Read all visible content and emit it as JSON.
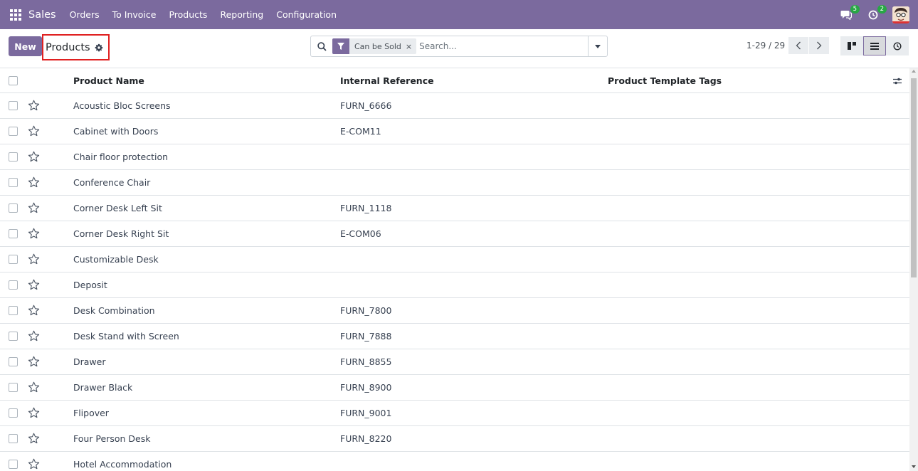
{
  "navbar": {
    "app_name": "Sales",
    "menu": [
      "Orders",
      "To Invoice",
      "Products",
      "Reporting",
      "Configuration"
    ],
    "messages_badge": "5",
    "activities_badge": "2"
  },
  "control_panel": {
    "new_label": "New",
    "title": "Products",
    "facet_label": "Can be Sold",
    "facet_close": "×",
    "search_placeholder": "Search...",
    "pager": "1-29 / 29"
  },
  "list": {
    "headers": {
      "name": "Product Name",
      "ref": "Internal Reference",
      "tags": "Product Template Tags"
    },
    "rows": [
      {
        "name": "Acoustic Bloc Screens",
        "ref": "FURN_6666"
      },
      {
        "name": "Cabinet with Doors",
        "ref": "E-COM11"
      },
      {
        "name": "Chair floor protection",
        "ref": ""
      },
      {
        "name": "Conference Chair",
        "ref": ""
      },
      {
        "name": "Corner Desk Left Sit",
        "ref": "FURN_1118"
      },
      {
        "name": "Corner Desk Right Sit",
        "ref": "E-COM06"
      },
      {
        "name": "Customizable Desk",
        "ref": ""
      },
      {
        "name": "Deposit",
        "ref": ""
      },
      {
        "name": "Desk Combination",
        "ref": "FURN_7800"
      },
      {
        "name": "Desk Stand with Screen",
        "ref": "FURN_7888"
      },
      {
        "name": "Drawer",
        "ref": "FURN_8855"
      },
      {
        "name": "Drawer Black",
        "ref": "FURN_8900"
      },
      {
        "name": "Flipover",
        "ref": "FURN_9001"
      },
      {
        "name": "Four Person Desk",
        "ref": "FURN_8220"
      },
      {
        "name": "Hotel Accommodation",
        "ref": ""
      }
    ]
  },
  "colors": {
    "brand": "#7b6a9e",
    "highlight_border": "#e02020",
    "badge": "#28a745"
  }
}
